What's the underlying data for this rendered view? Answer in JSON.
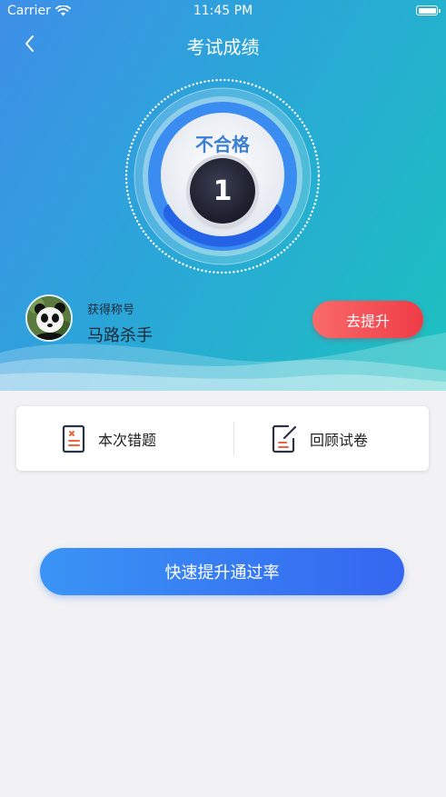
{
  "status_bar": {
    "carrier": "Carrier",
    "time": "11:45 PM"
  },
  "header": {
    "title": "考试成绩"
  },
  "result": {
    "status": "不合格",
    "score": "1"
  },
  "user": {
    "title_label": "获得称号",
    "title_value": "马路杀手",
    "improve_label": "去提升"
  },
  "actions": [
    {
      "label": "本次错题",
      "icon": "wrong-questions-doc-icon"
    },
    {
      "label": "回顾试卷",
      "icon": "review-paper-edit-icon"
    }
  ],
  "cta": {
    "label": "快速提升通过率"
  },
  "colors": {
    "accent_blue": "#3a7fd4",
    "accent_red": "#ef3c46",
    "icon_orange": "#f0643c"
  }
}
